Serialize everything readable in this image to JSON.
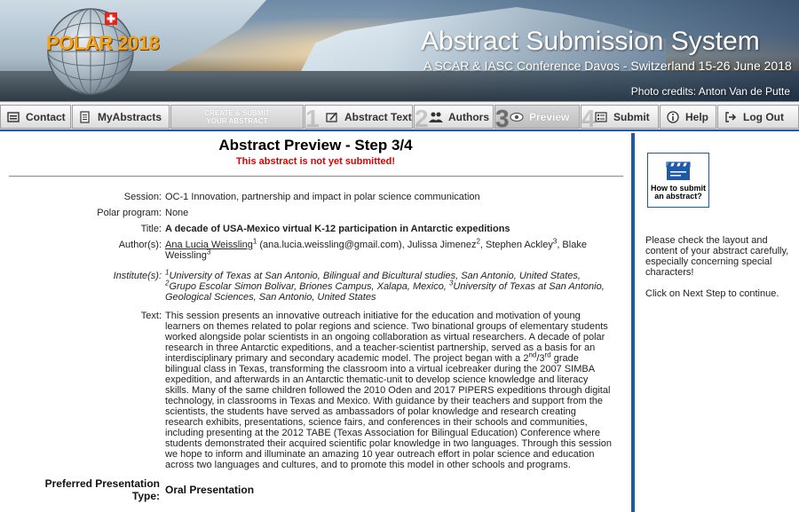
{
  "header": {
    "logo_text": "POLAR 2018",
    "title": "Abstract Submission System",
    "subtitle": "A SCAR & IASC Conference Davos - Switzerland 15-26 June 2018",
    "photo_credit": "Photo credits: Anton Van de Putte"
  },
  "nav": {
    "contact": "Contact",
    "my_abstracts": "MyAbstracts",
    "create_line1": "CREATE & SUBMIT",
    "create_line2": "YOUR ABSTRACT",
    "step1_num": "1",
    "abstract_text": "Abstract Text",
    "step2_num": "2",
    "authors": "Authors",
    "step3_num": "3",
    "preview": "Preview",
    "step4_num": "4",
    "submit": "Submit",
    "help": "Help",
    "logout": "Log Out"
  },
  "main": {
    "title": "Abstract Preview - Step 3/4",
    "warning": "This abstract is not yet submitted!",
    "session_label": "Session:",
    "session_value": "OC-1 Innovation, partnership and impact in polar science communication",
    "program_label": "Polar program:",
    "program_value": "None",
    "title_label": "Title:",
    "title_value": "A decade of USA-Mexico virtual K-12 participation in Antarctic expeditions",
    "authors_label": "Author(s):",
    "author1": "Ana Lucia Weissling",
    "author1_sup": "1",
    "author1_email": " (ana.lucia.weissling@gmail.com), Julissa Jimenez",
    "author2_sup": "2",
    "author3": ", Stephen Ackley",
    "author3_sup": "3",
    "author4": ", Blake Weissling",
    "author4_sup": "3",
    "institutes_label": "Institute(s):",
    "inst1_sup": "1",
    "inst1": "University of Texas at San Antonio, Bilingual and Bicultural studies, San Antonio, United States,",
    "inst2_sup": "2",
    "inst2": "Grupo Escolar Simon Bolivar, Briones Campus, Xalapa, Mexico, ",
    "inst3_sup": "3",
    "inst3": "University of Texas at San Antonio, Geological Sciences, San Antonio, United States",
    "text_label": "Text:",
    "text_part1": "This session presents an innovative outreach initiative for the education and motivation of young learners on themes related to polar regions and science. Two binational groups of elementary students worked alongside polar scientists in an ongoing collaboration as virtual researchers. A decade of polar research in three Antarctic expeditions, and a teacher-scientist partnership, served as a basis for an interdisciplinary primary and secondary academic model. The project began with a 2",
    "text_sup1": "nd",
    "text_slash": "/3",
    "text_sup2": "rd",
    "text_part2": " grade bilingual class in Texas, transforming the classroom into a virtual icebreaker during the 2007 SIMBA expedition, and afterwards in an Antarctic thematic-unit to develop science knowledge and literacy skills. Many of the same children followed the 2010 Oden and 2017 PIPERS expeditions through digital technology, in classrooms in Texas and Mexico. With guidance by their teachers and support from the scientists, the students have served as ambassadors of polar knowledge and research creating research exhibits, presentations, science fairs, and conferences in their schools and communities, including presenting at the 2012 TABE (Texas Association for Bilingual Education) Conference where students demonstrated their acquired scientific polar knowledge in two languages. Through this session we hope to inform and illuminate an amazing 10 year outreach effort in polar science and education across two languages and cultures, and to promote this model in other schools and programs.",
    "pref_label_line1": "Preferred Presentation",
    "pref_label_line2": "Type:",
    "pref_value": "Oral Presentation"
  },
  "side": {
    "help_button": "How to submit an abstract?",
    "note1": "Please check the layout and content of your abstract carefully, especially concerning special characters!",
    "note2": "Click on Next Step to continue."
  },
  "colors": {
    "accent_blue": "#1e5aa8",
    "warning_red": "#dd0000",
    "logo_orange": "#f4a21a"
  }
}
